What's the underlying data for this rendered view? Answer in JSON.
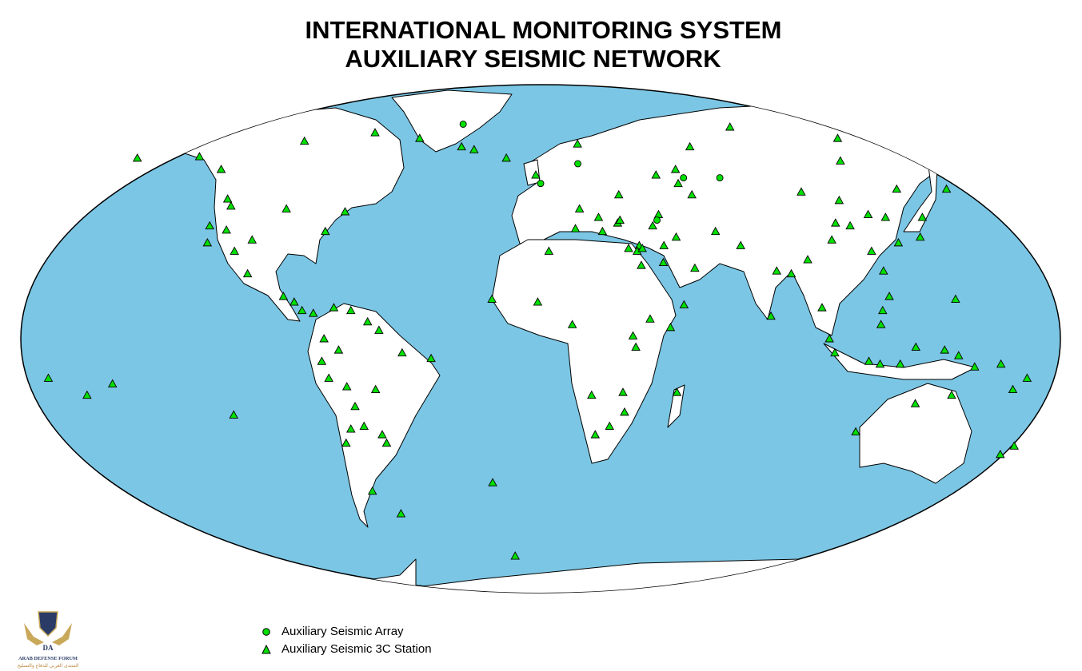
{
  "title": {
    "line1": "INTERNATIONAL MONITORING SYSTEM",
    "line2": "AUXILIARY SEISMIC NETWORK"
  },
  "legend": {
    "array_label": "Auxiliary Seismic Array",
    "station_label": "Auxiliary Seismic 3C Station"
  },
  "colors": {
    "ocean": "#7bc6e4",
    "land": "#ffffff",
    "outline": "#000000",
    "marker": "#00e000"
  },
  "watermark": {
    "text_en": "ARAB DEFENSE FORUM",
    "text_ar": "المنتدى العربي للدفاع والتسليح",
    "mark": "DA"
  },
  "stations": [
    [
      -176.5,
      64
    ],
    [
      -150,
      64.5
    ],
    [
      -135,
      60
    ],
    [
      -123,
      49.5
    ],
    [
      -120,
      47
    ],
    [
      -124,
      40
    ],
    [
      -117,
      38.5
    ],
    [
      -122,
      34
    ],
    [
      -106,
      35
    ],
    [
      -98,
      46
    ],
    [
      -75,
      45
    ],
    [
      -80,
      38
    ],
    [
      -111,
      31
    ],
    [
      -104,
      23
    ],
    [
      -90,
      15
    ],
    [
      -86,
      13
    ],
    [
      -83,
      10
    ],
    [
      -79,
      9
    ],
    [
      -72,
      11
    ],
    [
      -66,
      10
    ],
    [
      -60,
      6
    ],
    [
      -56,
      3
    ],
    [
      -75,
      0
    ],
    [
      -70,
      -4
    ],
    [
      -76,
      -8
    ],
    [
      -74,
      -14
    ],
    [
      -68,
      -17
    ],
    [
      -58,
      -18
    ],
    [
      -66,
      -24
    ],
    [
      -69,
      -32
    ],
    [
      -58,
      -34
    ],
    [
      -72,
      -37
    ],
    [
      -68,
      -54
    ],
    [
      -60,
      -62
    ],
    [
      -38,
      -7
    ],
    [
      -48,
      -5
    ],
    [
      -110,
      -27
    ],
    [
      -150,
      -16
    ],
    [
      -160,
      -20
    ],
    [
      -172,
      -14
    ],
    [
      -57,
      -37
    ],
    [
      -64,
      -31
    ],
    [
      -110,
      70
    ],
    [
      -80,
      73
    ],
    [
      -57,
      71
    ],
    [
      -30,
      67
    ],
    [
      -15,
      64
    ],
    [
      -2,
      58
    ],
    [
      17,
      69
    ],
    [
      -17,
      14
    ],
    [
      -1,
      13
    ],
    [
      3,
      31
    ],
    [
      13,
      39
    ],
    [
      15,
      46
    ],
    [
      23,
      38
    ],
    [
      22,
      43
    ],
    [
      29,
      41
    ],
    [
      36,
      33
    ],
    [
      35,
      31
    ],
    [
      32,
      32
    ],
    [
      37,
      32
    ],
    [
      44,
      27
    ],
    [
      45,
      33
    ],
    [
      36,
      26
    ],
    [
      50,
      36
    ],
    [
      55,
      25
    ],
    [
      50,
      12
    ],
    [
      45,
      4
    ],
    [
      38,
      7
    ],
    [
      32,
      1
    ],
    [
      33,
      -3
    ],
    [
      29,
      -19
    ],
    [
      18,
      -20
    ],
    [
      30,
      -26
    ],
    [
      25,
      -31
    ],
    [
      20,
      -34
    ],
    [
      48,
      -19
    ],
    [
      11,
      5
    ],
    [
      31,
      51
    ],
    [
      48,
      58
    ],
    [
      57,
      60
    ],
    [
      56,
      55
    ],
    [
      60,
      51
    ],
    [
      45,
      44
    ],
    [
      65,
      38
    ],
    [
      73,
      33
    ],
    [
      84,
      24
    ],
    [
      80,
      8
    ],
    [
      96,
      28
    ],
    [
      98,
      11
    ],
    [
      100,
      0
    ],
    [
      102,
      -5
    ],
    [
      114,
      -8
    ],
    [
      118,
      -9
    ],
    [
      125,
      -9
    ],
    [
      130,
      -3
    ],
    [
      118,
      5
    ],
    [
      119,
      10
    ],
    [
      122,
      15
    ],
    [
      122,
      24
    ],
    [
      120,
      31
    ],
    [
      131,
      34
    ],
    [
      140,
      36
    ],
    [
      145,
      43
    ],
    [
      131,
      43
    ],
    [
      125,
      44
    ],
    [
      104,
      52
    ],
    [
      111,
      41
    ],
    [
      117,
      49
    ],
    [
      116,
      40
    ],
    [
      107,
      35
    ],
    [
      89,
      23
    ],
    [
      140,
      -4
    ],
    [
      145,
      -6
    ],
    [
      151,
      -10
    ],
    [
      160,
      -9
    ],
    [
      170,
      -14
    ],
    [
      166,
      -18
    ],
    [
      176,
      -38
    ],
    [
      173,
      -41
    ],
    [
      115,
      -33
    ],
    [
      133,
      -23
    ],
    [
      145,
      -20
    ],
    [
      145,
      14
    ],
    [
      163,
      53
    ],
    [
      143,
      53
    ],
    [
      130,
      63
    ],
    [
      68,
      68
    ],
    [
      94,
      75
    ],
    [
      140,
      71
    ],
    [
      30,
      42
    ],
    [
      42,
      40
    ],
    [
      -36,
      68
    ],
    [
      -19,
      -51
    ],
    [
      -13,
      -77
    ]
  ],
  "arrays": [
    [
      -39,
      76
    ],
    [
      16,
      62
    ],
    [
      0,
      55
    ],
    [
      44,
      42
    ],
    [
      59,
      57
    ],
    [
      74,
      57
    ]
  ]
}
